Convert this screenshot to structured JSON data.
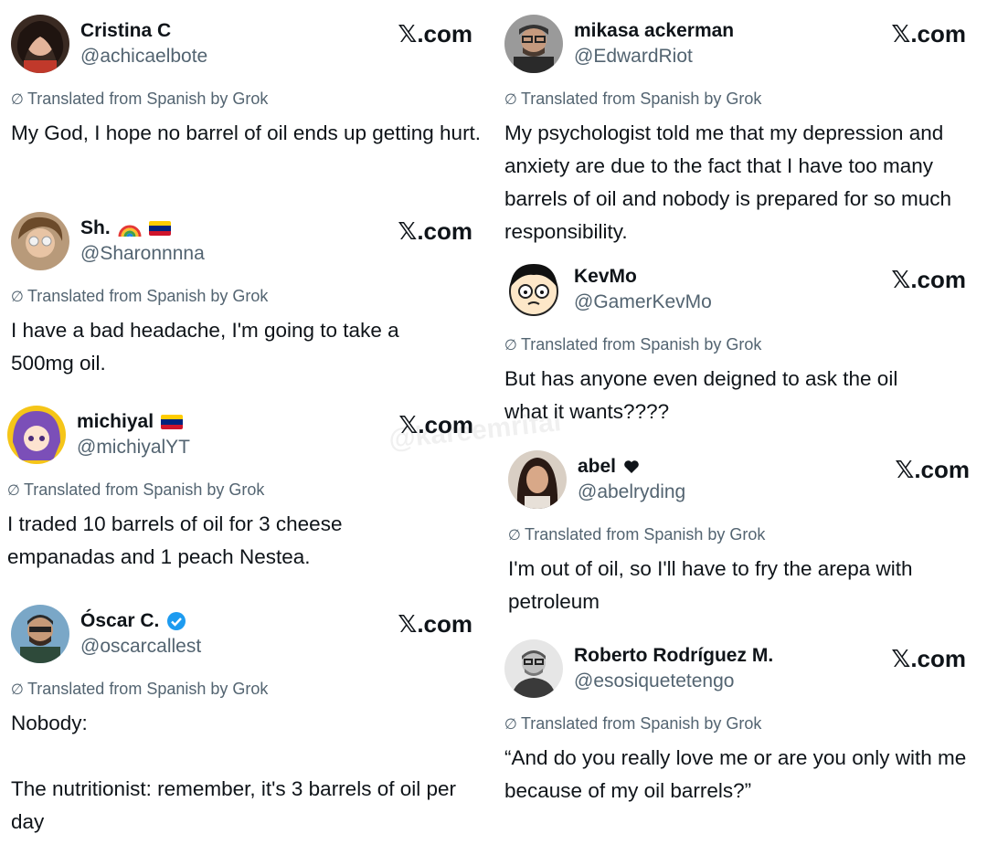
{
  "watermark": "@kareemrifai",
  "xlogo": {
    "mark": "𝕏",
    "text": ".com"
  },
  "grok_label": "Translated from Spanish by Grok",
  "tweets": [
    {
      "name": "Cristina C",
      "handle": "@achicaelbote",
      "text": "My God, I hope no barrel of oil ends up getting hurt."
    },
    {
      "name": "Sh.",
      "handle": "@Sharonnnna",
      "text": "I have a bad headache, I'm going to take a 500mg oil."
    },
    {
      "name": "michiyal",
      "handle": "@michiyalYT",
      "text": "I traded 10 barrels of oil for 3 cheese empanadas and 1 peach Nestea."
    },
    {
      "name": "Óscar C.",
      "handle": "@oscarcallest",
      "text_line1": "Nobody:",
      "text_line2": "The nutritionist: remember, it's 3 barrels of oil per day"
    },
    {
      "name": "mikasa ackerman",
      "handle": "@EdwardRiot",
      "text": "My psychologist told me that my depression and anxiety are due to the fact that I have too many barrels of oil and nobody is prepared for so much responsibility."
    },
    {
      "name": "KevMo",
      "handle": "@GamerKevMo",
      "text": "But has anyone even deigned to ask the oil what it wants????"
    },
    {
      "name": "abel",
      "handle": "@abelryding",
      "text": "I'm out of oil, so I'll have to fry the arepa with petroleum"
    },
    {
      "name": "Roberto Rodríguez M.",
      "handle": "@esosiquetetengo",
      "text": "“And do you really love me or are you only with me because of my oil barrels?”"
    }
  ],
  "colors": {
    "text": "#0f1419",
    "muted": "#536471",
    "verified": "#1d9bf0",
    "flag_yellow": "#ffcc00",
    "flag_blue": "#00247d",
    "flag_red": "#cf142b"
  },
  "icons": [
    "x-logo-icon",
    "translate-slash-icon",
    "rainbow-icon",
    "venezuela-flag-icon",
    "verified-badge-icon",
    "heart-icon"
  ]
}
